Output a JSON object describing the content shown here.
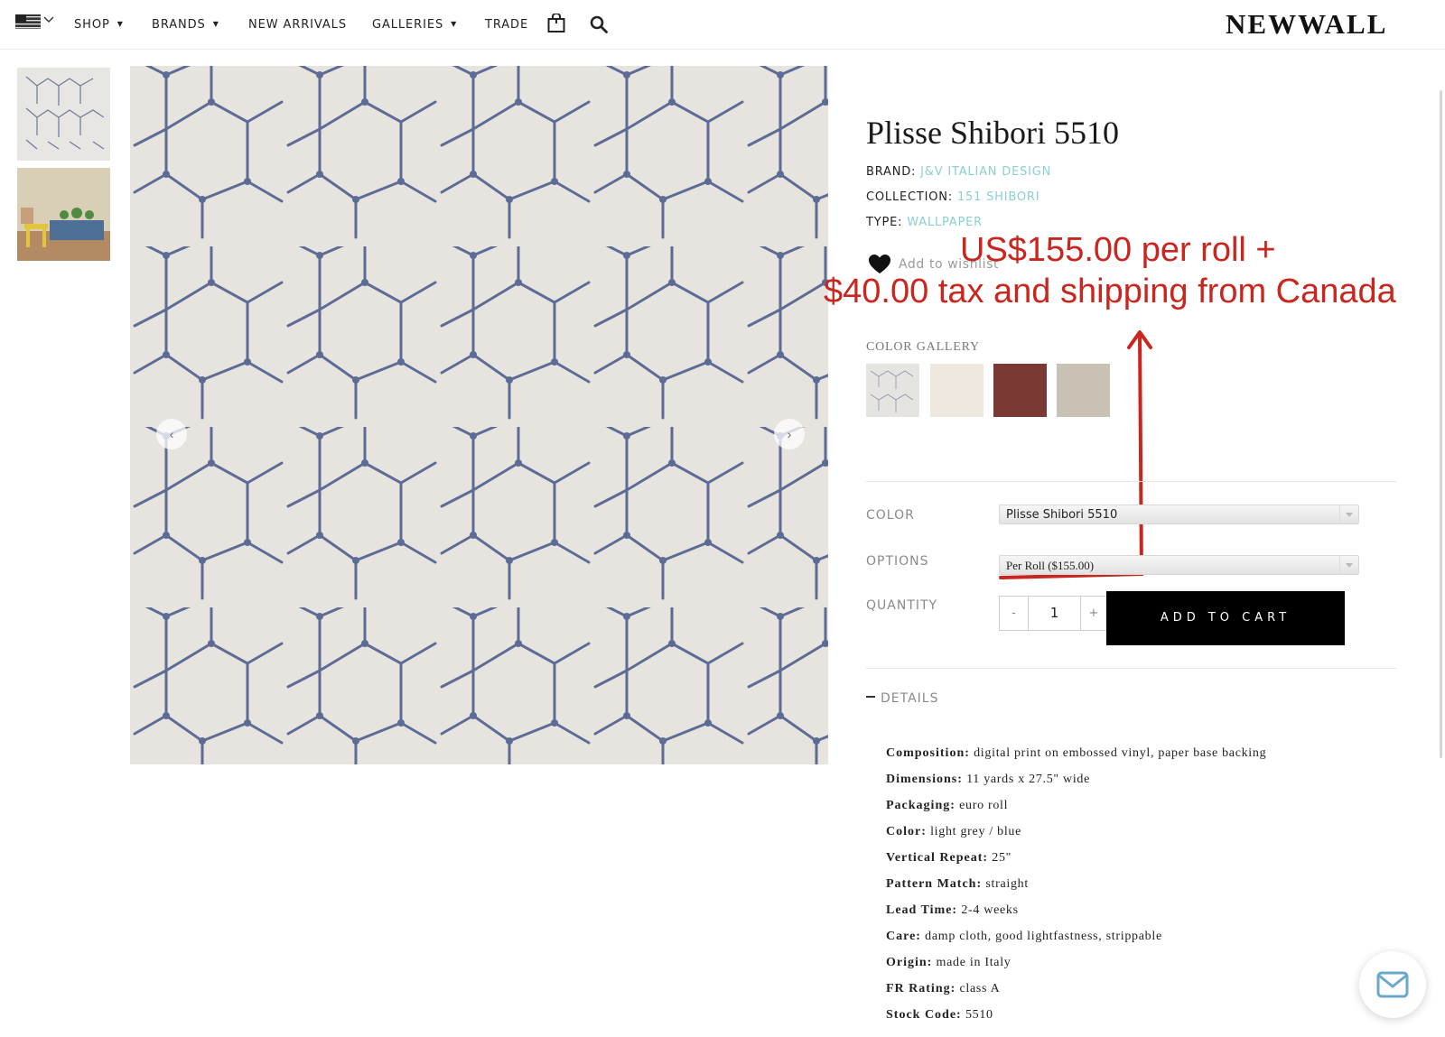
{
  "header": {
    "country_icon": "us-flag-icon",
    "nav": [
      {
        "label": "SHOP",
        "has_dropdown": true
      },
      {
        "label": "BRANDS",
        "has_dropdown": true
      },
      {
        "label": "NEW ARRIVALS",
        "has_dropdown": false
      },
      {
        "label": "GALLERIES",
        "has_dropdown": true
      },
      {
        "label": "TRADE",
        "has_dropdown": false
      }
    ],
    "icons": [
      "shopping-bag-icon",
      "search-icon"
    ],
    "logo": "NEWWALL"
  },
  "gallery": {
    "thumbnails": [
      "pattern-thumbnail",
      "room-scene-thumbnail"
    ],
    "prev_arrow": "‹",
    "next_arrow": "›"
  },
  "product": {
    "title": "Plisse Shibori 5510",
    "brand_label": "BRAND:",
    "brand": "J&V ITALIAN DESIGN",
    "collection_label": "COLLECTION:",
    "collection": "151 SHIBORI",
    "type_label": "TYPE:",
    "type": "WALLPAPER",
    "wishlist": "Add to wishlist",
    "link_color": "#8ccfd2"
  },
  "annotation": {
    "line1": "US$155.00 per roll +",
    "line2": "$40.00 tax and shipping from Canada",
    "color": "#c8261e"
  },
  "color_gallery": {
    "label": "COLOR GALLERY",
    "swatches": [
      "#e6e4e1",
      "#efe8df",
      "#7a3a33",
      "#c9c2b4"
    ]
  },
  "options": {
    "color_label": "COLOR",
    "color_value": "Plisse Shibori 5510",
    "options_label": "OPTIONS",
    "options_value": "Per Roll ($155.00)",
    "quantity_label": "QUANTITY",
    "quantity": "1",
    "minus": "-",
    "plus": "+",
    "add_to_cart": "ADD TO CART"
  },
  "details": {
    "toggle_label": "DETAILS",
    "specs": [
      {
        "label": "Composition:",
        "value": "digital print on embossed vinyl, paper base backing"
      },
      {
        "label": "Dimensions:",
        "value": "11 yards x 27.5\" wide"
      },
      {
        "label": "Packaging:",
        "value": "euro roll"
      },
      {
        "label": "Color:",
        "value": "light grey / blue"
      },
      {
        "label": "Vertical Repeat:",
        "value": "25\""
      },
      {
        "label": "Pattern Match:",
        "value": "straight"
      },
      {
        "label": "Lead Time:",
        "value": "2-4 weeks"
      },
      {
        "label": "Care:",
        "value": "damp cloth, good lightfastness, strippable"
      },
      {
        "label": "Origin:",
        "value": "made in Italy"
      },
      {
        "label": "FR Rating:",
        "value": "class A"
      },
      {
        "label": "Stock Code:",
        "value": "5510"
      }
    ]
  },
  "floating": {
    "mail_icon": "mail-icon"
  }
}
